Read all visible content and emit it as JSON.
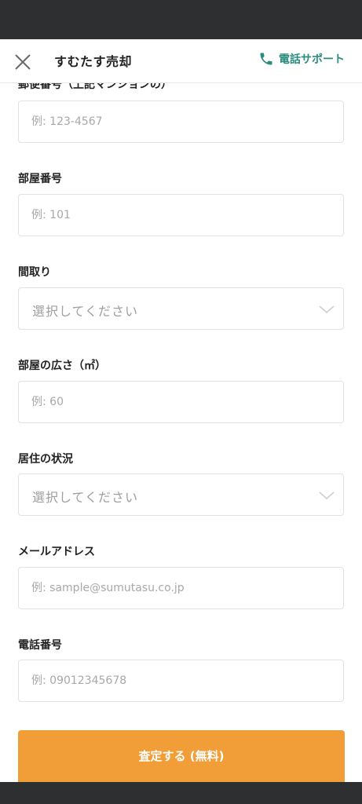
{
  "header": {
    "title": "すむたす売却",
    "support_label": "電話サポート"
  },
  "form": {
    "fields": [
      {
        "label": "郵便番号（上記マンションの）",
        "placeholder": "例: 123-4567"
      },
      {
        "label": "部屋番号",
        "placeholder": "例: 101"
      },
      {
        "label": "間取り",
        "select_value": "選択してください"
      },
      {
        "label": "部屋の広さ（㎡）",
        "placeholder": "例: 60"
      },
      {
        "label": "居住の状況",
        "select_value": "選択してください"
      },
      {
        "label": "メールアドレス",
        "placeholder": "例: sample@sumutasu.co.jp"
      },
      {
        "label": "電話番号",
        "placeholder": "例: 09012345678"
      }
    ],
    "submit_label": "査定する (無料)"
  },
  "colors": {
    "accent_green": "#2a8c7d",
    "submit_orange": "#f29e38",
    "system_bar": "#2e2f31"
  },
  "icons": {
    "close": "close-icon",
    "phone": "phone-icon",
    "chevron": "chevron-down-icon"
  }
}
